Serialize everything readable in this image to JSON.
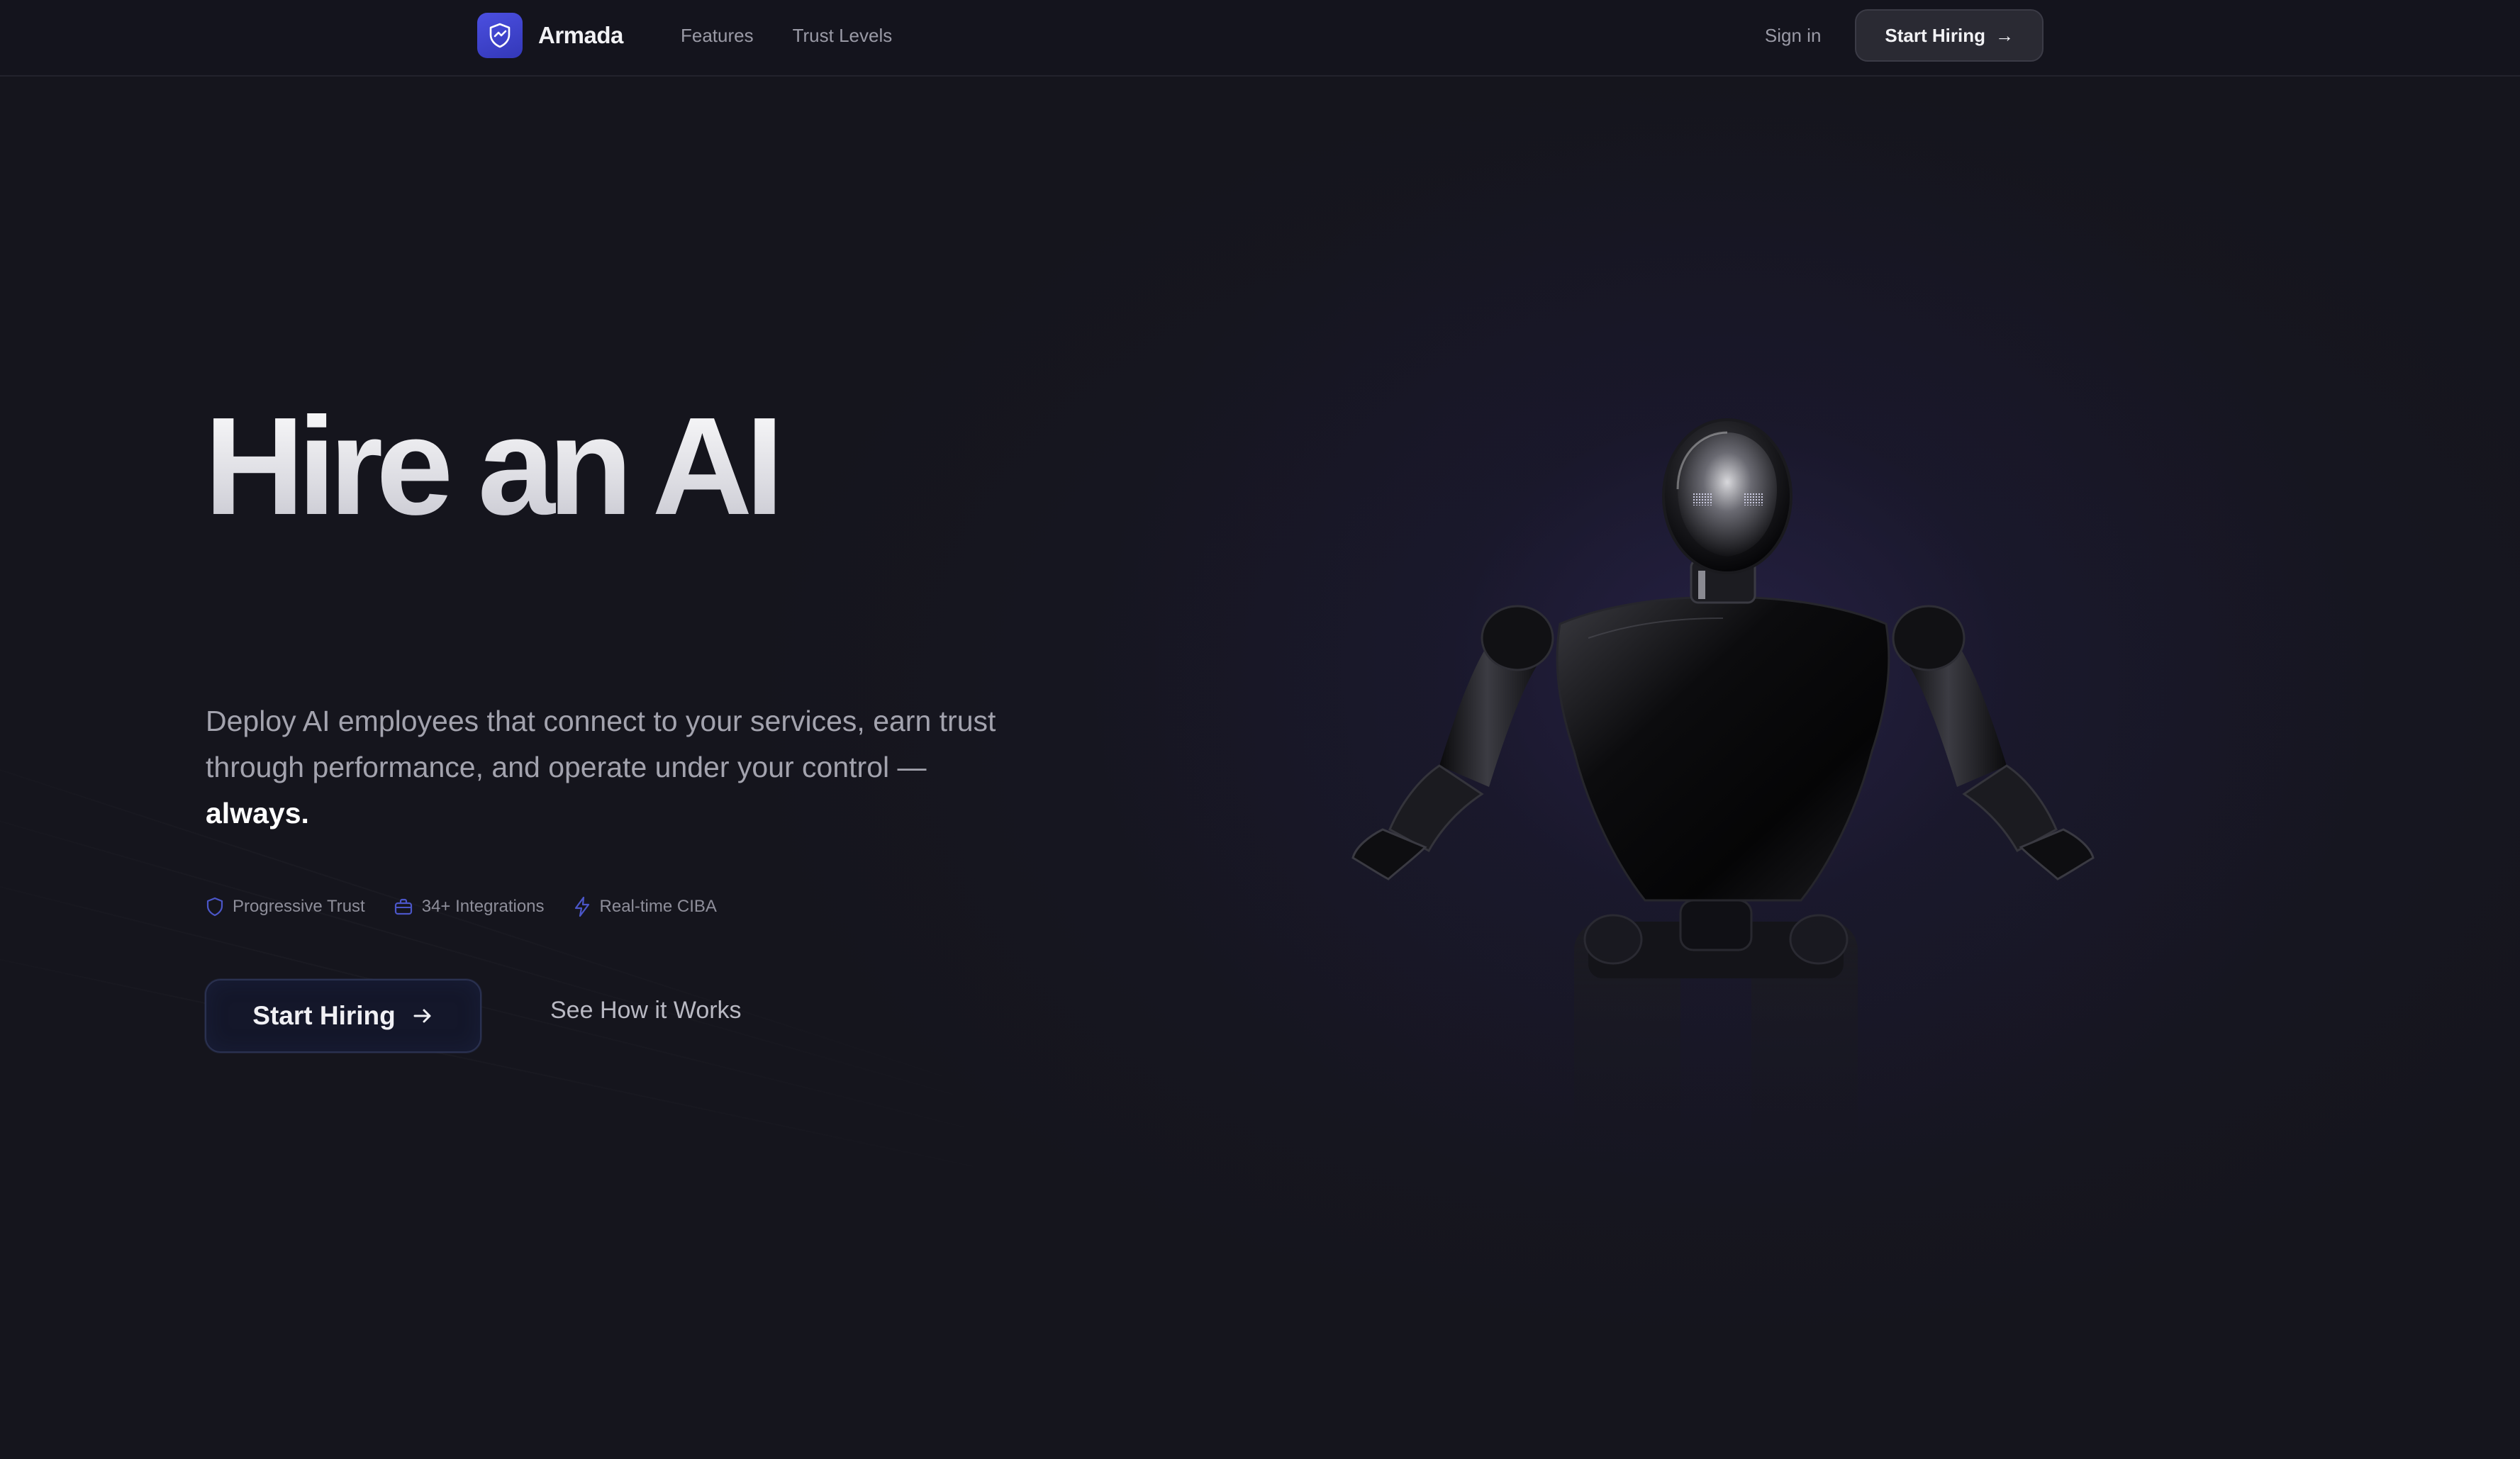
{
  "brand": {
    "name": "Armada",
    "logo_icon": "shield-check-icon",
    "accent": "#4146d6"
  },
  "nav": {
    "links": [
      {
        "label": "Features"
      },
      {
        "label": "Trust Levels"
      }
    ],
    "signin_label": "Sign in",
    "cta_label": "Start Hiring",
    "cta_arrow": "→"
  },
  "hero": {
    "title": "Hire an AI",
    "subtitle": "Deploy AI employees that connect to your services, earn trust through performance, and operate under your control —",
    "subtitle_emphasis": "always.",
    "features": [
      {
        "label": "Progressive Trust",
        "icon": "shield-icon"
      },
      {
        "label": "34+ Integrations",
        "icon": "briefcase-icon"
      },
      {
        "label": "Real-time CIBA",
        "icon": "lightning-icon"
      }
    ],
    "primary_button": "Start Hiring",
    "secondary_button": "See How it Works",
    "illustration": "robot-illustration"
  },
  "colors": {
    "background": "#15151d",
    "nav_border": "#23232d",
    "feature_icon": "#4b56c8",
    "muted_text": "#a3a3ae"
  }
}
